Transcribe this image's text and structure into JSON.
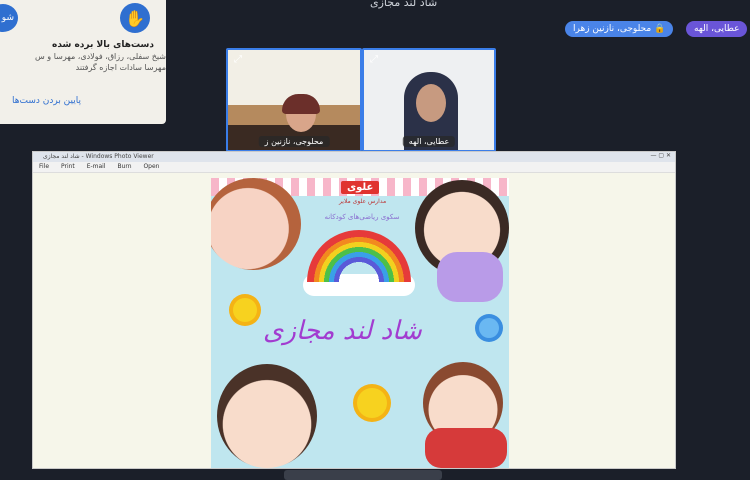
{
  "top_title": "شاد لند مجازی",
  "hands_panel": {
    "title": "دست‌های بالا برده شده",
    "names_line1": "شیخ سفلی، رزاق، فولادی، مهرسا و س",
    "names_line2": "مهرسا سادات اجازه گرفتند",
    "lower_all": "پایین بردن دست‌ها",
    "side_button_label": "شو"
  },
  "chips": [
    {
      "label": "عطایی، الهه"
    },
    {
      "label": "محلوجی، نازنین زهرا"
    }
  ],
  "tiles": [
    {
      "label": "محلوجی، نازنین ز"
    },
    {
      "label": "عطایی، الهه"
    }
  ],
  "share": {
    "window_title": "شاد لند مجازی - Windows Photo Viewer",
    "menus": [
      "File",
      "Print",
      "E-mail",
      "Burn",
      "Open"
    ],
    "poster": {
      "brand": "علوی",
      "brand_sub": "مدارس علوی ملایر",
      "subtitle": "سکوی ریاضی‌های کودکانه",
      "headline": "شاد لند مجازی"
    }
  },
  "colors": {
    "background": "#1b1f29",
    "accent_blue": "#3a7de8",
    "chip_purple": "#6a55d8",
    "brand_red": "#e0332f"
  }
}
